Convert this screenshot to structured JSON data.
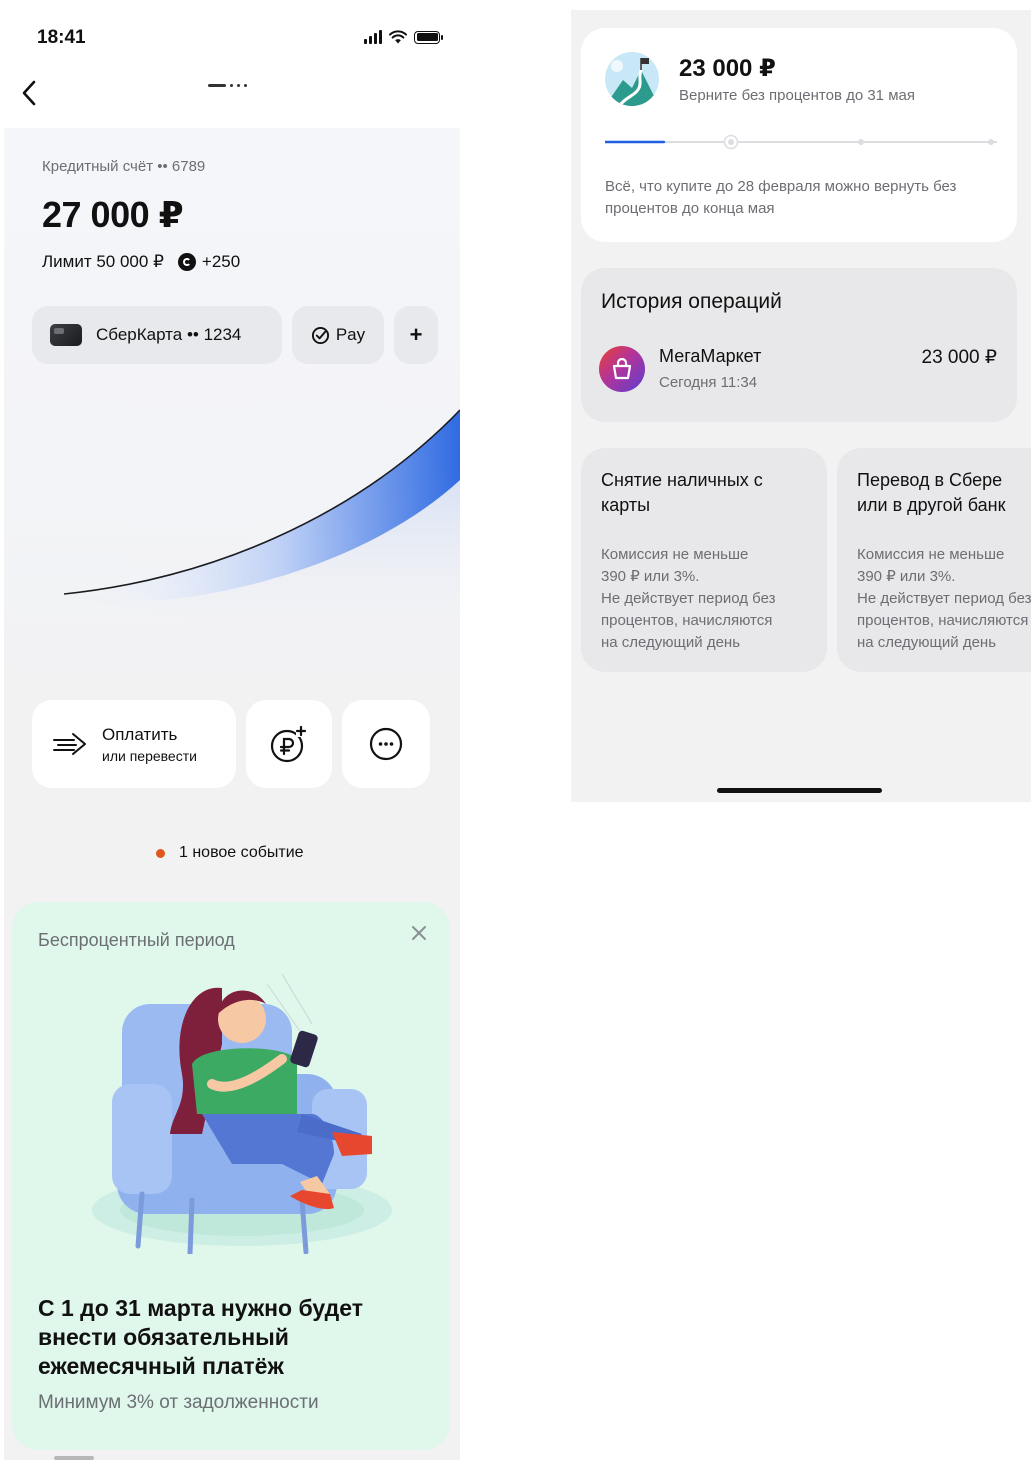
{
  "status_bar": {
    "time": "18:41"
  },
  "account": {
    "label": "Кредитный счёт •• 6789",
    "balance": "27 000 ₽",
    "limit": "Лимит 50 000 ₽",
    "bonus": "+250"
  },
  "chips": {
    "card_label": "СберКарта •• 1234",
    "pay_label": "Pay",
    "add_label": "+"
  },
  "actions": {
    "pay_title": "Оплатить",
    "pay_subtitle": "или перевести"
  },
  "events": {
    "label": "1 новое событие"
  },
  "promo": {
    "label": "Беспроцентный период",
    "title": "С 1 до 31 марта нужно будет внести обязательный ежемесячный платёж",
    "subtitle": "Минимум 3% от задолженности"
  },
  "grace": {
    "amount": "23 000 ₽",
    "subtitle": "Верните без процентов до 31 мая",
    "progress": 0.15,
    "note": "Всё, что купите до 28 февраля можно вернуть без процентов до конца мая"
  },
  "history": {
    "title": "История операций",
    "operations": [
      {
        "name": "МегаМаркет",
        "time": "Сегодня 11:34",
        "amount": "23 000 ₽"
      }
    ]
  },
  "info_cards": [
    {
      "title": "Снятие наличных с карты",
      "lines": [
        "Комиссия не меньше",
        "390 ₽ или 3%.",
        "Не действует период без",
        "процентов, начисляются",
        "на следующий день"
      ]
    },
    {
      "title": "Перевод в Сбере или в другой банк",
      "lines": [
        "Комиссия не меньше",
        "390 ₽ или 3%.",
        "Не действует период без",
        "процентов, начисляются",
        "на следующий день"
      ]
    }
  ],
  "colors": {
    "accent_blue": "#1f5fe0",
    "event_dot": "#e0561c",
    "promo_bg": "#e0f7ec"
  }
}
